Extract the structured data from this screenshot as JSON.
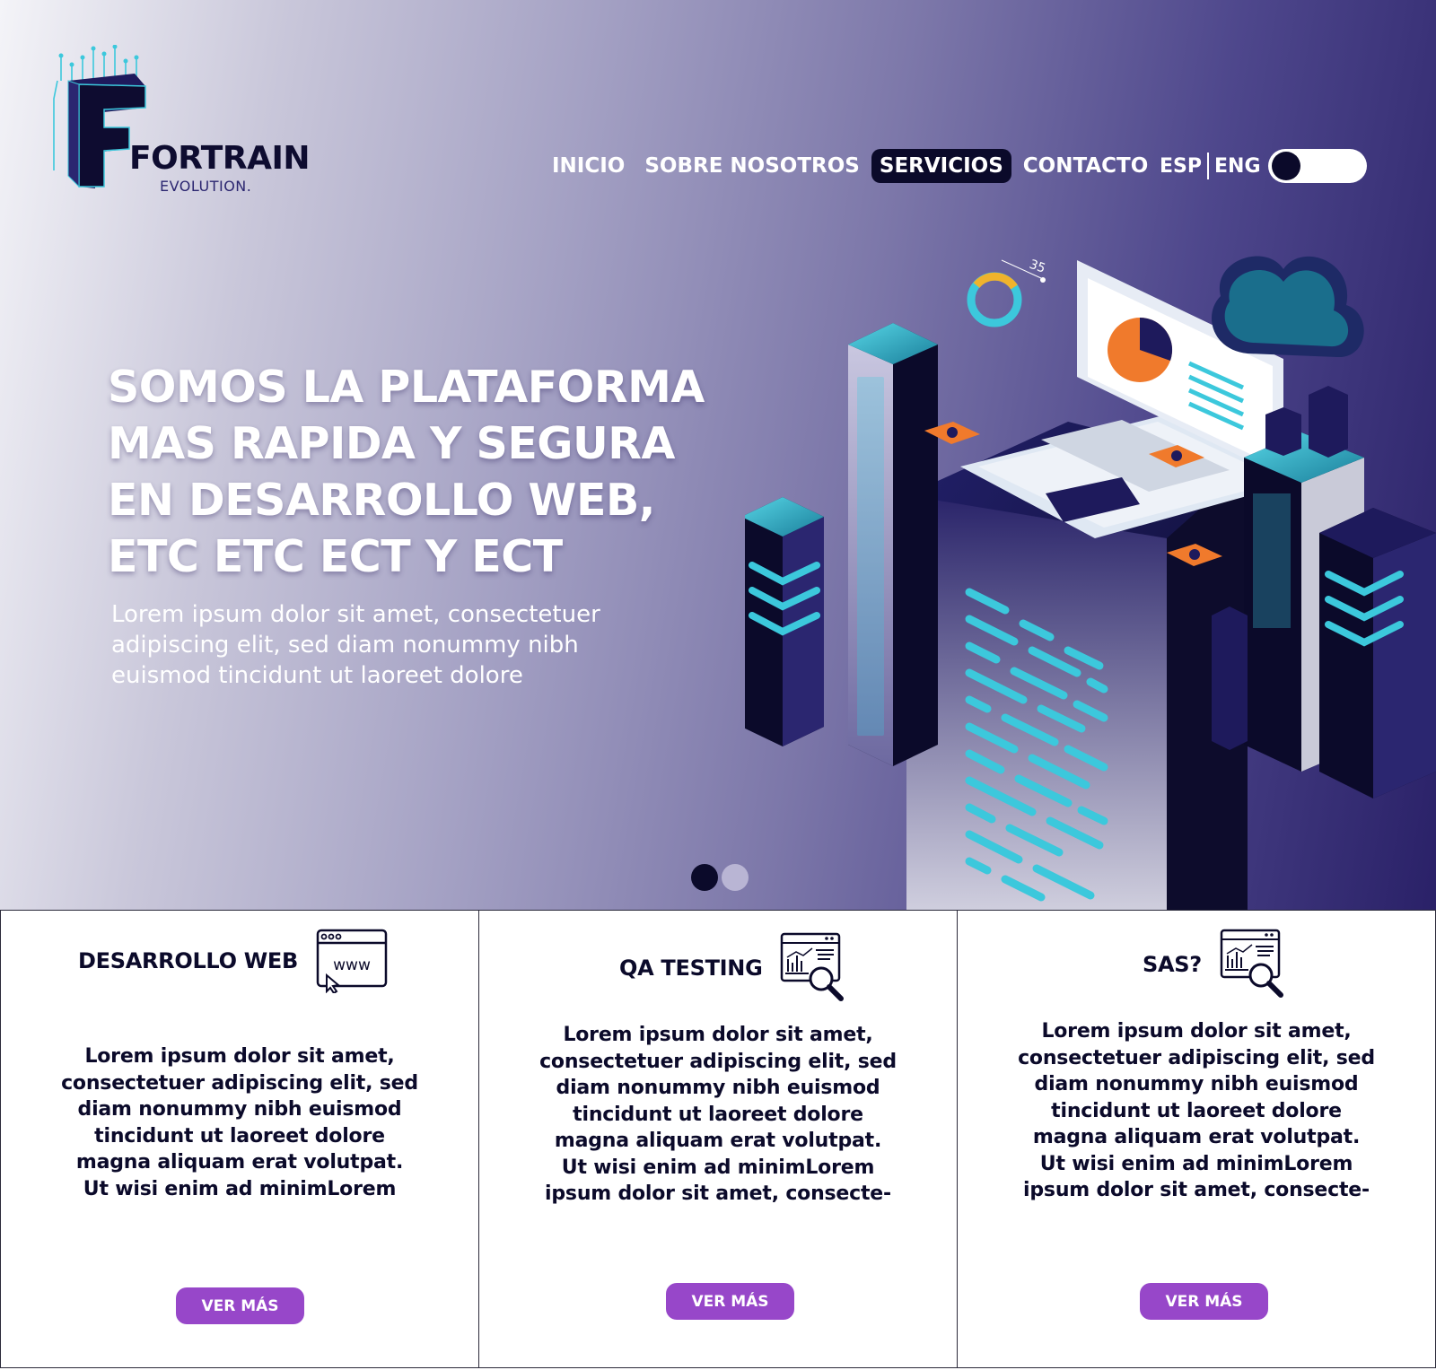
{
  "brand": {
    "name": "FORTRAIN",
    "tagline": "EVOLUTION."
  },
  "nav": {
    "items": [
      {
        "label": "INICIO"
      },
      {
        "label": "SOBRE NOSOTROS"
      },
      {
        "label": "SERVICIOS",
        "active": true
      },
      {
        "label": "CONTACTO"
      }
    ]
  },
  "language": {
    "es": "ESP",
    "en": "ENG"
  },
  "hero": {
    "title_lines": [
      "SOMOS LA PLATAFORMA",
      "MAS RAPIDA Y SEGURA",
      "EN DESARROLLO WEB,",
      "ETC ETC ECT Y ECT"
    ],
    "subtitle_lines": [
      "Lorem ipsum dolor sit amet, consectetuer",
      "adipiscing elit, sed diam nonummy nibh",
      "euismod tincidunt ut laoreet dolore"
    ],
    "illustration_label": "35"
  },
  "services": [
    {
      "title": "DESARROLLO WEB",
      "icon": "browser-www-icon",
      "icon_text": "www",
      "text_lines": [
        "Lorem ipsum dolor sit amet,",
        "consectetuer adipiscing elit, sed",
        "diam nonummy nibh euismod",
        "tincidunt ut laoreet dolore",
        "magna aliquam erat volutpat.",
        "Ut wisi enim ad minimLorem"
      ],
      "button": "VER MÁS"
    },
    {
      "title": "QA TESTING",
      "icon": "analytics-search-icon",
      "text_lines": [
        "Lorem ipsum dolor sit amet,",
        "consectetuer adipiscing elit, sed",
        "diam nonummy nibh euismod",
        "tincidunt ut laoreet dolore",
        "magna aliquam erat volutpat.",
        "Ut wisi enim ad minimLorem",
        "ipsum dolor sit amet, consecte-"
      ],
      "button": "VER MÁS"
    },
    {
      "title": "SAS?",
      "icon": "analytics-search-icon",
      "text_lines": [
        "Lorem ipsum dolor sit amet,",
        "consectetuer adipiscing elit, sed",
        "diam nonummy nibh euismod",
        "tincidunt ut laoreet dolore",
        "magna aliquam erat volutpat.",
        "Ut wisi enim ad minimLorem",
        "ipsum dolor sit amet, consecte-"
      ],
      "button": "VER MÁS"
    }
  ],
  "colors": {
    "dark": "#0b0a2a",
    "accent": "#9747c9",
    "cyan": "#3cc8dc",
    "orange": "#f07a2c"
  }
}
